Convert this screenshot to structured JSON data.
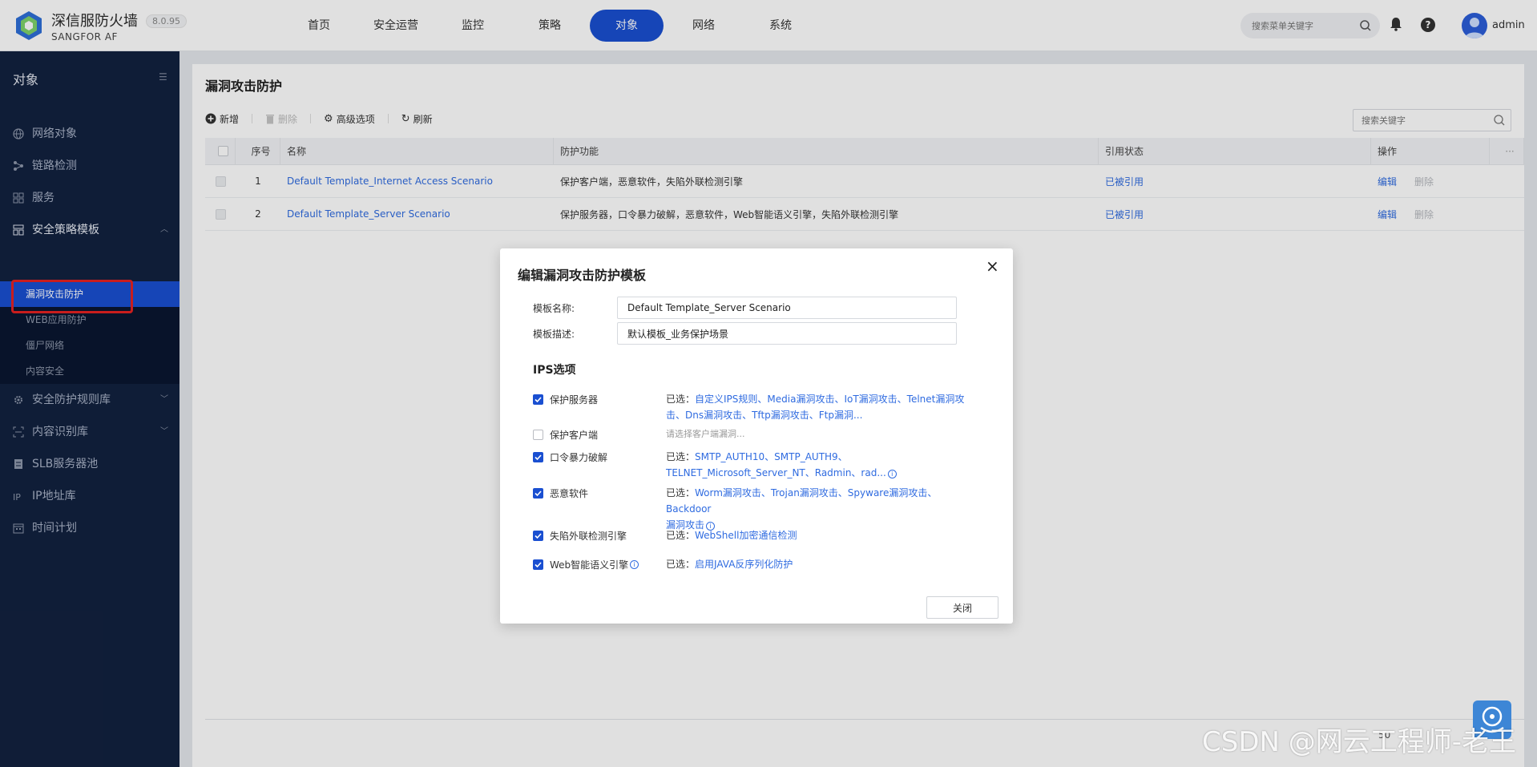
{
  "header": {
    "brand_title": "深信服防火墙",
    "brand_sub": "SANGFOR AF",
    "version": "8.0.95",
    "nav": [
      "首页",
      "安全运营",
      "监控",
      "策略",
      "对象",
      "网络",
      "系统"
    ],
    "nav_active": "对象",
    "search_placeholder": "搜索菜单关键字",
    "username": "admin",
    "help_label": "?"
  },
  "sidebar": {
    "title": "对象",
    "items": [
      {
        "label": "网络对象",
        "icon": "globe-icon"
      },
      {
        "label": "链路检测",
        "icon": "link-icon"
      },
      {
        "label": "服务",
        "icon": "grid-icon"
      },
      {
        "label": "安全策略模板",
        "icon": "template-icon"
      },
      {
        "label": "安全防护规则库",
        "icon": "gear-icon"
      },
      {
        "label": "内容识别库",
        "icon": "scan-icon"
      },
      {
        "label": "SLB服务器池",
        "icon": "server-icon"
      },
      {
        "label": "IP地址库",
        "icon": "ip-icon"
      },
      {
        "label": "时间计划",
        "icon": "calendar-icon"
      }
    ],
    "sub_items": [
      "漏洞攻击防护",
      "WEB应用防护",
      "僵尸网络",
      "内容安全"
    ],
    "active_sub": "漏洞攻击防护"
  },
  "page": {
    "title": "漏洞攻击防护",
    "toolbar": {
      "add": "新增",
      "delete": "删除",
      "advanced": "高级选项",
      "refresh": "刷新"
    },
    "search_placeholder": "搜索关键字",
    "columns": [
      "序号",
      "名称",
      "防护功能",
      "引用状态",
      "操作"
    ],
    "rows": [
      {
        "idx": "1",
        "name": "Default Template_Internet Access Scenario",
        "func": "保护客户端，恶意软件，失陷外联检测引擎",
        "ref": "已被引用",
        "edit": "编辑",
        "del": "删除"
      },
      {
        "idx": "2",
        "name": "Default Template_Server Scenario",
        "func": "保护服务器，口令暴力破解，恶意软件，Web智能语义引擎，失陷外联检测引擎",
        "ref": "已被引用",
        "edit": "编辑",
        "del": "删除"
      }
    ],
    "footer_fragment": "50"
  },
  "modal": {
    "title": "编辑漏洞攻击防护模板",
    "name_label": "模板名称:",
    "name_value": "Default Template_Server Scenario",
    "desc_label": "模板描述:",
    "desc_value": "默认模板_业务保护场景",
    "section": "IPS选项",
    "selected_prefix": "已选：",
    "options": [
      {
        "label": "保护服务器",
        "checked": true,
        "line1": "自定义IPS规则、Media漏洞攻击、IoT漏洞攻击、Telnet漏洞攻",
        "line2": "击、Dns漏洞攻击、Tftp漏洞攻击、Ftp漏洞..."
      },
      {
        "label": "保护客户端",
        "checked": false,
        "placeholder": "请选择客户端漏洞..."
      },
      {
        "label": "口令暴力破解",
        "checked": true,
        "line1": "SMTP_AUTH10、SMTP_AUTH9、",
        "line2": "TELNET_Microsoft_Server_NT、Radmin、rad..."
      },
      {
        "label": "恶意软件",
        "checked": true,
        "line1": "Worm漏洞攻击、Trojan漏洞攻击、Spyware漏洞攻击、Backdoor",
        "line2": "漏洞攻击"
      },
      {
        "label": "失陷外联检测引擎",
        "checked": true,
        "line1": "WebShell加密通信检测"
      },
      {
        "label": "Web智能语义引擎",
        "checked": true,
        "line1": "启用JAVA反序列化防护"
      }
    ],
    "close_button": "关闭",
    "close_icon": "×"
  },
  "watermark": "CSDN @网云工程师-老王",
  "colors": {
    "accent": "#1a4fd1",
    "sidebar_bg": "#12213f",
    "link": "#2f6be0",
    "highlight_box": "#e52222"
  }
}
